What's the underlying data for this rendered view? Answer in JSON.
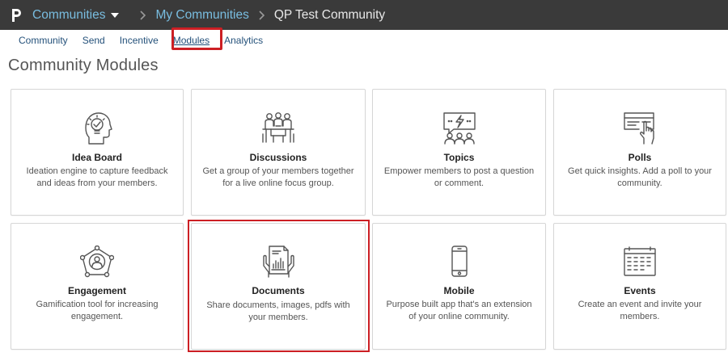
{
  "header": {
    "crumbs": {
      "communities": "Communities",
      "my_communities": "My Communities",
      "current": "QP Test Community"
    }
  },
  "tabs": [
    {
      "label": "Community"
    },
    {
      "label": "Send"
    },
    {
      "label": "Incentive"
    },
    {
      "label": "Modules",
      "active": true
    },
    {
      "label": "Analytics"
    }
  ],
  "page_title": "Community Modules",
  "modules": [
    {
      "title": "Idea Board",
      "description": "Ideation engine to capture feedback and ideas from your members.",
      "icon": "lightbulb-head-icon"
    },
    {
      "title": "Discussions",
      "description": "Get a group of your members together for a live online focus group.",
      "icon": "meeting-table-icon"
    },
    {
      "title": "Topics",
      "description": "Empower members to post a question or comment.",
      "icon": "speech-screen-icon"
    },
    {
      "title": "Polls",
      "description": "Get quick insights. Add a poll to your community.",
      "icon": "poll-card-hand-icon"
    },
    {
      "title": "Engagement",
      "description": "Gamification tool for increasing engagement.",
      "icon": "network-user-icon"
    },
    {
      "title": "Documents",
      "description": "Share documents, images, pdfs with your members.",
      "icon": "document-hands-icon"
    },
    {
      "title": "Mobile",
      "description": "Purpose built app that's an extension of your online community.",
      "icon": "smartphone-icon"
    },
    {
      "title": "Events",
      "description": "Create an event and invite your members.",
      "icon": "calendar-icon"
    }
  ],
  "colors": {
    "topbar": "#3a3a3a",
    "link": "#79bde0",
    "tab_text": "#24517a",
    "highlight": "#cc1f24"
  }
}
